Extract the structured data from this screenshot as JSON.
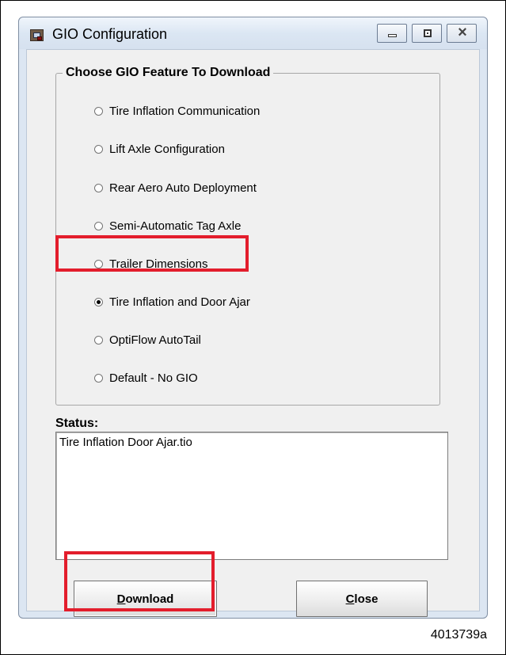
{
  "window": {
    "title": "GIO Configuration",
    "controls": {
      "minimize_icon": "minimize-icon",
      "maximize_icon": "maximize-icon",
      "close_icon": "close-icon"
    }
  },
  "feature_group": {
    "label": "Choose GIO Feature To Download",
    "options": [
      {
        "label": "Tire Inflation Communication",
        "selected": false
      },
      {
        "label": "Lift Axle Configuration",
        "selected": false
      },
      {
        "label": "Rear Aero Auto Deployment",
        "selected": false
      },
      {
        "label": "Semi-Automatic Tag Axle",
        "selected": false
      },
      {
        "label": "Trailer Dimensions",
        "selected": false
      },
      {
        "label": "Tire Inflation and Door Ajar",
        "selected": true
      },
      {
        "label": "OptiFlow AutoTail",
        "selected": false
      },
      {
        "label": "Default - No GIO",
        "selected": false
      }
    ]
  },
  "status": {
    "label": "Status:",
    "value": "Tire Inflation Door Ajar.tio"
  },
  "buttons": {
    "download": {
      "mnemonic": "D",
      "rest": "ownload"
    },
    "close": {
      "mnemonic": "C",
      "rest": "lose"
    }
  },
  "annotation": {
    "figure_id": "4013739a",
    "highlight_color": "#e31d2c"
  }
}
